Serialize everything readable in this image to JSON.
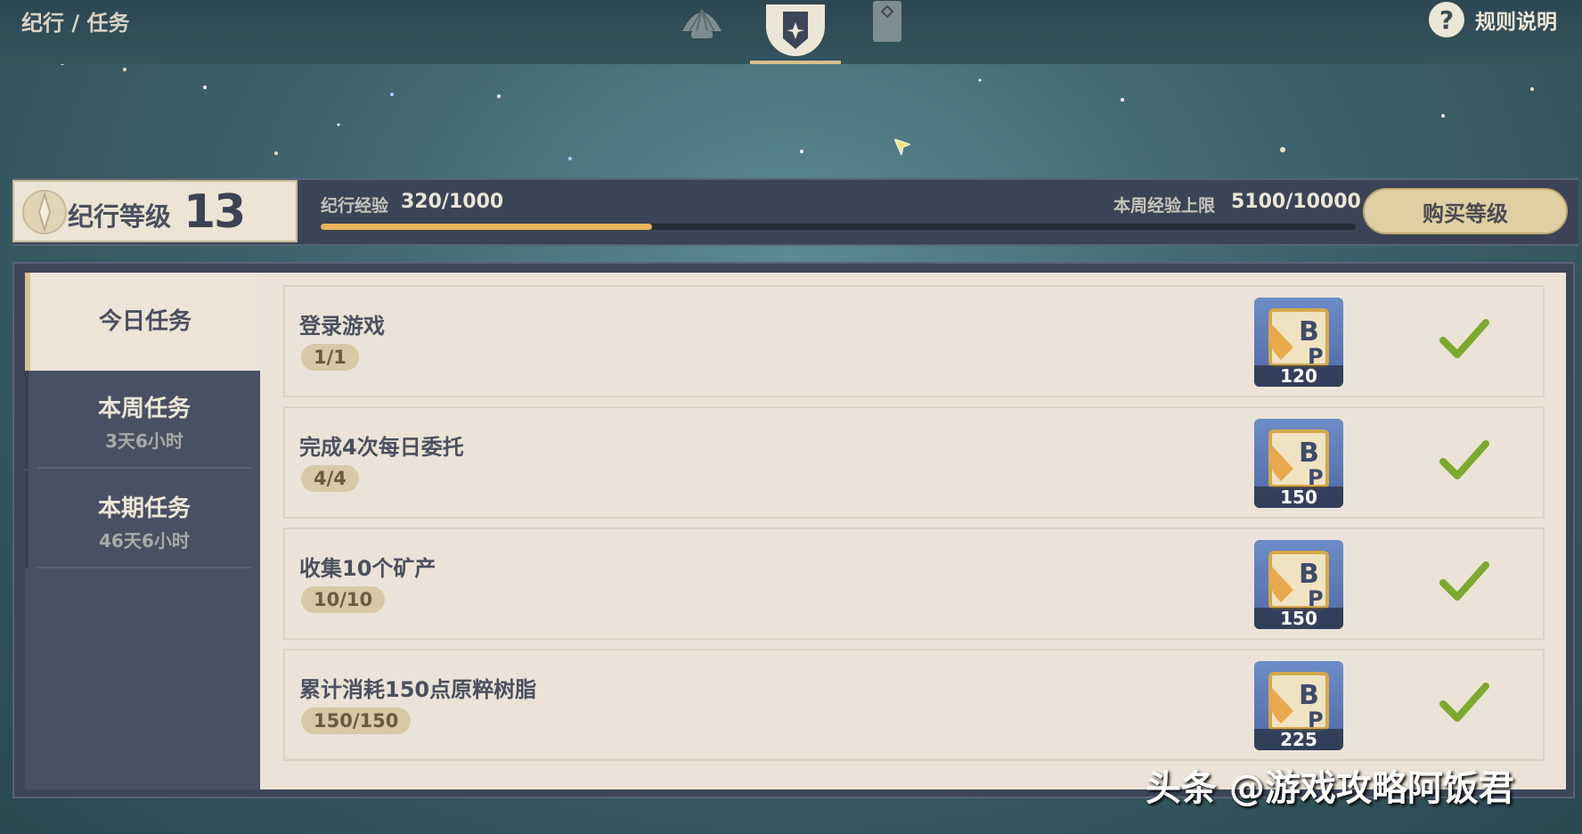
{
  "topbar": {
    "breadcrumb": "纪行 / 任务",
    "rules_label": "规则说明",
    "rules_icon": "?"
  },
  "level": {
    "label": "纪行等级",
    "value": "13",
    "exp_label": "纪行经验",
    "exp_value": "320/1000",
    "exp_progress": 0.32,
    "weekly_cap_label": "本周经验上限",
    "weekly_cap_value": "5100/10000",
    "buy_button": "购买等级"
  },
  "sidebar": {
    "tabs": [
      {
        "title": "今日任务",
        "subtitle": ""
      },
      {
        "title": "本周任务",
        "subtitle": "3天6小时"
      },
      {
        "title": "本期任务",
        "subtitle": "46天6小时"
      }
    ]
  },
  "tasks": [
    {
      "name": "登录游戏",
      "progress": "1/1",
      "reward": "120"
    },
    {
      "name": "完成4次每日委托",
      "progress": "4/4",
      "reward": "150"
    },
    {
      "name": "收集10个矿产",
      "progress": "10/10",
      "reward": "150"
    },
    {
      "name": "累计消耗150点原粹树脂",
      "progress": "150/150",
      "reward": "225"
    }
  ],
  "watermark": "头条 @游戏攻略阿饭君",
  "colors": {
    "accent_gold": "#e9b35a",
    "check_green": "#7ea82e",
    "panel_bg": "#3d4558",
    "content_bg": "#ebe3d7"
  }
}
